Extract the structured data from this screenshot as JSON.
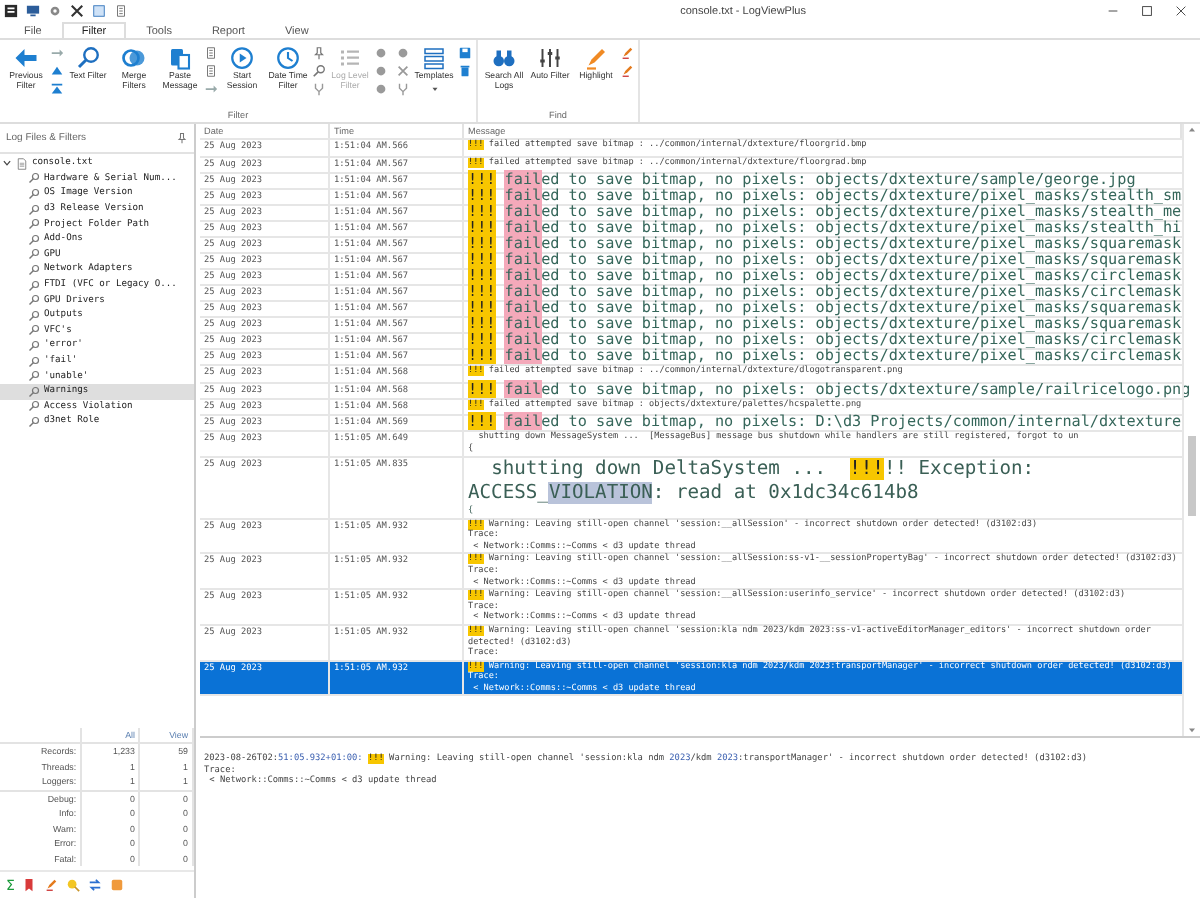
{
  "window": {
    "title": "console.txt - LogViewPlus"
  },
  "menu": [
    {
      "label": "File",
      "selected": false
    },
    {
      "label": "Filter",
      "selected": true
    },
    {
      "label": "Tools",
      "selected": false
    },
    {
      "label": "Report",
      "selected": false
    },
    {
      "label": "View",
      "selected": false
    }
  ],
  "ribbon": {
    "groups": [
      {
        "label": "Filter",
        "buttons": [
          {
            "label": "Previous Filter",
            "disabled": false
          },
          {
            "label": "Text Filter",
            "disabled": false
          },
          {
            "label": "Merge Filters",
            "disabled": false
          },
          {
            "label": "Paste Message",
            "disabled": false
          },
          {
            "label": "Start Session",
            "disabled": false
          },
          {
            "label": "Date Time Filter",
            "disabled": false
          },
          {
            "label": "Log Level Filter",
            "disabled": true
          },
          {
            "label": "Templates",
            "disabled": false
          }
        ]
      },
      {
        "label": "Find",
        "buttons": [
          {
            "label": "Search All Logs",
            "disabled": false
          },
          {
            "label": "Auto Filter",
            "disabled": false
          },
          {
            "label": "Highlight",
            "disabled": false
          }
        ]
      }
    ]
  },
  "side_panel": {
    "title": "Log Files & Filters",
    "tree": [
      {
        "label": "console.txt",
        "expanded": true,
        "selected": false,
        "children": [
          {
            "label": "Hardware & Serial Num...",
            "selected": false
          },
          {
            "label": "OS Image Version",
            "selected": false
          },
          {
            "label": "d3 Release Version",
            "selected": false
          },
          {
            "label": "Project Folder Path",
            "selected": false
          },
          {
            "label": "Add-Ons",
            "selected": false
          },
          {
            "label": "GPU",
            "selected": false
          },
          {
            "label": "Network Adapters",
            "selected": false
          },
          {
            "label": "FTDI (VFC or Legacy O...",
            "selected": false
          },
          {
            "label": "GPU Drivers",
            "selected": false
          },
          {
            "label": "Outputs",
            "selected": false
          },
          {
            "label": "VFC's",
            "selected": false
          },
          {
            "label": "'error'",
            "selected": false
          },
          {
            "label": "'fail'",
            "selected": false
          },
          {
            "label": "'unable'",
            "selected": false
          },
          {
            "label": "Warnings",
            "selected": true
          },
          {
            "label": "Access Violation",
            "selected": false
          },
          {
            "label": "d3net Role",
            "selected": false
          }
        ]
      }
    ],
    "stats": {
      "columns": [
        "All",
        "View"
      ],
      "rows": [
        {
          "label": "Records:",
          "values": [
            "1,233",
            "59"
          ]
        },
        {
          "label": "Threads:",
          "values": [
            "1",
            "1"
          ]
        },
        {
          "label": "Loggers:",
          "values": [
            "1",
            "1"
          ]
        },
        {
          "label": "Debug:",
          "values": [
            "0",
            "0"
          ]
        },
        {
          "label": "Info:",
          "values": [
            "0",
            "0"
          ]
        },
        {
          "label": "Warn:",
          "values": [
            "0",
            "0"
          ]
        },
        {
          "label": "Error:",
          "values": [
            "0",
            "0"
          ]
        },
        {
          "label": "Fatal:",
          "values": [
            "0",
            "0"
          ]
        }
      ]
    },
    "toolbar_symbol": "Σ"
  },
  "log": {
    "columns": [
      "Date",
      "Time",
      "Message"
    ],
    "rows": [
      {
        "date": "25 Aug 2023",
        "time": "1:51:04 AM.566",
        "kind": "small",
        "selected": false,
        "segments": [
          {
            "text": "!!!",
            "kind": "marker"
          },
          {
            "text": " failed attempted save bitmap : ../common/internal/dxtexture/floorgrid.bmp",
            "kind": "plain"
          }
        ]
      },
      {
        "date": "25 Aug 2023",
        "time": "1:51:04 AM.567",
        "kind": "small",
        "selected": false,
        "segments": [
          {
            "text": "!!!",
            "kind": "marker"
          },
          {
            "text": " failed attempted save bitmap : ../common/internal/dxtexture/floorgrad.bmp",
            "kind": "plain"
          }
        ]
      },
      {
        "date": "25 Aug 2023",
        "time": "1:51:04 AM.567",
        "kind": "large",
        "selected": false,
        "segments": [
          {
            "text": "!!!",
            "kind": "marker"
          },
          {
            "text": " fail",
            "kind": "match"
          },
          {
            "text": "ed to save bitmap, no pixels: objects/dxtexture/sample/george.jpg",
            "kind": "plain"
          }
        ]
      },
      {
        "date": "25 Aug 2023",
        "time": "1:51:04 AM.567",
        "kind": "large",
        "selected": false,
        "segments": [
          {
            "text": "!!!",
            "kind": "marker"
          },
          {
            "text": " fail",
            "kind": "match"
          },
          {
            "text": "ed to save bitmap, no pixels: objects/dxtexture/pixel_masks/stealth_sm",
            "kind": "plain"
          }
        ]
      },
      {
        "date": "25 Aug 2023",
        "time": "1:51:04 AM.567",
        "kind": "large",
        "selected": false,
        "segments": [
          {
            "text": "!!!",
            "kind": "marker"
          },
          {
            "text": " fail",
            "kind": "match"
          },
          {
            "text": "ed to save bitmap, no pixels: objects/dxtexture/pixel_masks/stealth_me",
            "kind": "plain"
          }
        ]
      },
      {
        "date": "25 Aug 2023",
        "time": "1:51:04 AM.567",
        "kind": "large",
        "selected": false,
        "segments": [
          {
            "text": "!!!",
            "kind": "marker"
          },
          {
            "text": " fail",
            "kind": "match"
          },
          {
            "text": "ed to save bitmap, no pixels: objects/dxtexture/pixel_masks/stealth_hi",
            "kind": "plain"
          }
        ]
      },
      {
        "date": "25 Aug 2023",
        "time": "1:51:04 AM.567",
        "kind": "large",
        "selected": false,
        "segments": [
          {
            "text": "!!!",
            "kind": "marker"
          },
          {
            "text": " fail",
            "kind": "match"
          },
          {
            "text": "ed to save bitmap, no pixels: objects/dxtexture/pixel_masks/squaremask",
            "kind": "plain"
          }
        ]
      },
      {
        "date": "25 Aug 2023",
        "time": "1:51:04 AM.567",
        "kind": "large",
        "selected": false,
        "segments": [
          {
            "text": "!!!",
            "kind": "marker"
          },
          {
            "text": " fail",
            "kind": "match"
          },
          {
            "text": "ed to save bitmap, no pixels: objects/dxtexture/pixel_masks/squaremask",
            "kind": "plain"
          }
        ]
      },
      {
        "date": "25 Aug 2023",
        "time": "1:51:04 AM.567",
        "kind": "large",
        "selected": false,
        "segments": [
          {
            "text": "!!!",
            "kind": "marker"
          },
          {
            "text": " fail",
            "kind": "match"
          },
          {
            "text": "ed to save bitmap, no pixels: objects/dxtexture/pixel_masks/circlemask",
            "kind": "plain"
          }
        ]
      },
      {
        "date": "25 Aug 2023",
        "time": "1:51:04 AM.567",
        "kind": "large",
        "selected": false,
        "segments": [
          {
            "text": "!!!",
            "kind": "marker"
          },
          {
            "text": " fail",
            "kind": "match"
          },
          {
            "text": "ed to save bitmap, no pixels: objects/dxtexture/pixel_masks/circlemask",
            "kind": "plain"
          }
        ]
      },
      {
        "date": "25 Aug 2023",
        "time": "1:51:04 AM.567",
        "kind": "large",
        "selected": false,
        "segments": [
          {
            "text": "!!!",
            "kind": "marker"
          },
          {
            "text": " fail",
            "kind": "match"
          },
          {
            "text": "ed to save bitmap, no pixels: objects/dxtexture/pixel_masks/squaremask",
            "kind": "plain"
          }
        ]
      },
      {
        "date": "25 Aug 2023",
        "time": "1:51:04 AM.567",
        "kind": "large",
        "selected": false,
        "segments": [
          {
            "text": "!!!",
            "kind": "marker"
          },
          {
            "text": " fail",
            "kind": "match"
          },
          {
            "text": "ed to save bitmap, no pixels: objects/dxtexture/pixel_masks/squaremask",
            "kind": "plain"
          }
        ]
      },
      {
        "date": "25 Aug 2023",
        "time": "1:51:04 AM.567",
        "kind": "large",
        "selected": false,
        "segments": [
          {
            "text": "!!!",
            "kind": "marker"
          },
          {
            "text": " fail",
            "kind": "match"
          },
          {
            "text": "ed to save bitmap, no pixels: objects/dxtexture/pixel_masks/circlemask",
            "kind": "plain"
          }
        ]
      },
      {
        "date": "25 Aug 2023",
        "time": "1:51:04 AM.567",
        "kind": "large",
        "selected": false,
        "segments": [
          {
            "text": "!!!",
            "kind": "marker"
          },
          {
            "text": " fail",
            "kind": "match"
          },
          {
            "text": "ed to save bitmap, no pixels: objects/dxtexture/pixel_masks/circlemask",
            "kind": "plain"
          }
        ]
      },
      {
        "date": "25 Aug 2023",
        "time": "1:51:04 AM.568",
        "kind": "small",
        "selected": false,
        "segments": [
          {
            "text": "!!!",
            "kind": "marker"
          },
          {
            "text": " failed attempted save bitmap : ../common/internal/dxtexture/dlogotransparent.png",
            "kind": "plain"
          }
        ]
      },
      {
        "date": "25 Aug 2023",
        "time": "1:51:04 AM.568",
        "kind": "large",
        "selected": false,
        "segments": [
          {
            "text": "!!!",
            "kind": "marker"
          },
          {
            "text": " fail",
            "kind": "match"
          },
          {
            "text": "ed to save bitmap, no pixels: objects/dxtexture/sample/railricelogo.png",
            "kind": "plain"
          }
        ]
      },
      {
        "date": "25 Aug 2023",
        "time": "1:51:04 AM.568",
        "kind": "small",
        "selected": false,
        "segments": [
          {
            "text": "!!!",
            "kind": "marker"
          },
          {
            "text": " failed attempted save bitmap : objects/dxtexture/palettes/hcspalette.png",
            "kind": "plain"
          }
        ]
      },
      {
        "date": "25 Aug 2023",
        "time": "1:51:04 AM.569",
        "kind": "large",
        "selected": false,
        "segments": [
          {
            "text": "!!!",
            "kind": "marker"
          },
          {
            "text": " fail",
            "kind": "match"
          },
          {
            "text": "ed to save bitmap, no pixels: D:\\d3 Projects/common/internal/dxtexture",
            "kind": "plain"
          }
        ]
      },
      {
        "date": "25 Aug 2023",
        "time": "1:51:05 AM.649",
        "kind": "small",
        "selected": false,
        "segments": [
          {
            "text": "  shutting down MessageSystem ...  [MessageBus] message bus shutdown while handlers are still registered, forgot to un",
            "kind": "plain"
          }
        ],
        "extra_lines": [
          "{"
        ]
      },
      {
        "date": "25 Aug 2023",
        "time": "1:51:05 AM.835",
        "kind": "huge",
        "selected": false,
        "segments": [
          {
            "text": "  shutting down DeltaSystem ...  ",
            "kind": "plain"
          },
          {
            "text": "!!!",
            "kind": "marker"
          },
          {
            "text": "!! Exception: ACCESS_",
            "kind": "plain"
          },
          {
            "text": "VIOLATION",
            "kind": "term"
          },
          {
            "text": ": read at 0x1dc34c614b8",
            "kind": "plain"
          }
        ],
        "extra_lines": [
          "{"
        ]
      },
      {
        "date": "25 Aug 2023",
        "time": "1:51:05 AM.932",
        "kind": "small",
        "selected": false,
        "segments": [
          {
            "text": "!!!",
            "kind": "marker"
          },
          {
            "text": " Warning: Leaving still-open channel 'session:__allSession' - incorrect shutdown order detected! (d3102:d3)",
            "kind": "plain"
          }
        ],
        "extra_lines": [
          "Trace:",
          " < Network::Comms::~Comms < d3 update thread"
        ]
      },
      {
        "date": "25 Aug 2023",
        "time": "1:51:05 AM.932",
        "kind": "small",
        "selected": false,
        "segments": [
          {
            "text": "!!!",
            "kind": "marker"
          },
          {
            "text": " Warning: Leaving still-open channel 'session:__allSession:ss-v1-__sessionPropertyBag' - incorrect shutdown order detected! (d3102:d3)",
            "kind": "plain"
          }
        ],
        "extra_lines": [
          "Trace:",
          " < Network::Comms::~Comms < d3 update thread"
        ]
      },
      {
        "date": "25 Aug 2023",
        "time": "1:51:05 AM.932",
        "kind": "small",
        "selected": false,
        "segments": [
          {
            "text": "!!!",
            "kind": "marker"
          },
          {
            "text": " Warning: Leaving still-open channel 'session:__allSession:userinfo_service' - incorrect shutdown order detected! (d3102:d3)",
            "kind": "plain"
          }
        ],
        "extra_lines": [
          "Trace:",
          " < Network::Comms::~Comms < d3 update thread"
        ]
      },
      {
        "date": "25 Aug 2023",
        "time": "1:51:05 AM.932",
        "kind": "small",
        "selected": false,
        "segments": [
          {
            "text": "!!!",
            "kind": "marker"
          },
          {
            "text": " Warning: Leaving still-open channel 'session:kla ndm 2023/kdm 2023:ss-v1-activeEditorManager_editors' - incorrect shutdown order detected! (d3102:d3)",
            "kind": "plain"
          }
        ],
        "extra_lines": [
          "Trace:"
        ]
      },
      {
        "date": "25 Aug 2023",
        "time": "1:51:05 AM.932",
        "kind": "small",
        "selected": true,
        "segments": [
          {
            "text": "!!!",
            "kind": "marker"
          },
          {
            "text": " Warning: Leaving still-open channel 'session:kla ndm 2023/kdm 2023:transportManager' - incorrect shutdown order detected! (d3102:d3)",
            "kind": "plain"
          }
        ],
        "extra_lines": [
          "Trace:",
          " < Network::Comms::~Comms < d3 update thread"
        ]
      }
    ]
  },
  "detail": {
    "segments": [
      {
        "text": "2023-08-26T02:",
        "kind": "plain"
      },
      {
        "text": "51:05.932+01:00:",
        "kind": "time"
      },
      {
        "text": " !!!",
        "kind": "marker"
      },
      {
        "text": " Warning: Leaving still-open channel 'session:kla ndm ",
        "kind": "plain"
      },
      {
        "text": "2023",
        "kind": "number"
      },
      {
        "text": "/kdm ",
        "kind": "plain"
      },
      {
        "text": "2023",
        "kind": "number"
      },
      {
        "text": ":transportManager' - incorrect shutdown order detected! (d3102:d3)",
        "kind": "plain"
      }
    ],
    "extra_lines": [
      "Trace:",
      " < Network::Comms::~Comms < d3 update thread"
    ]
  }
}
